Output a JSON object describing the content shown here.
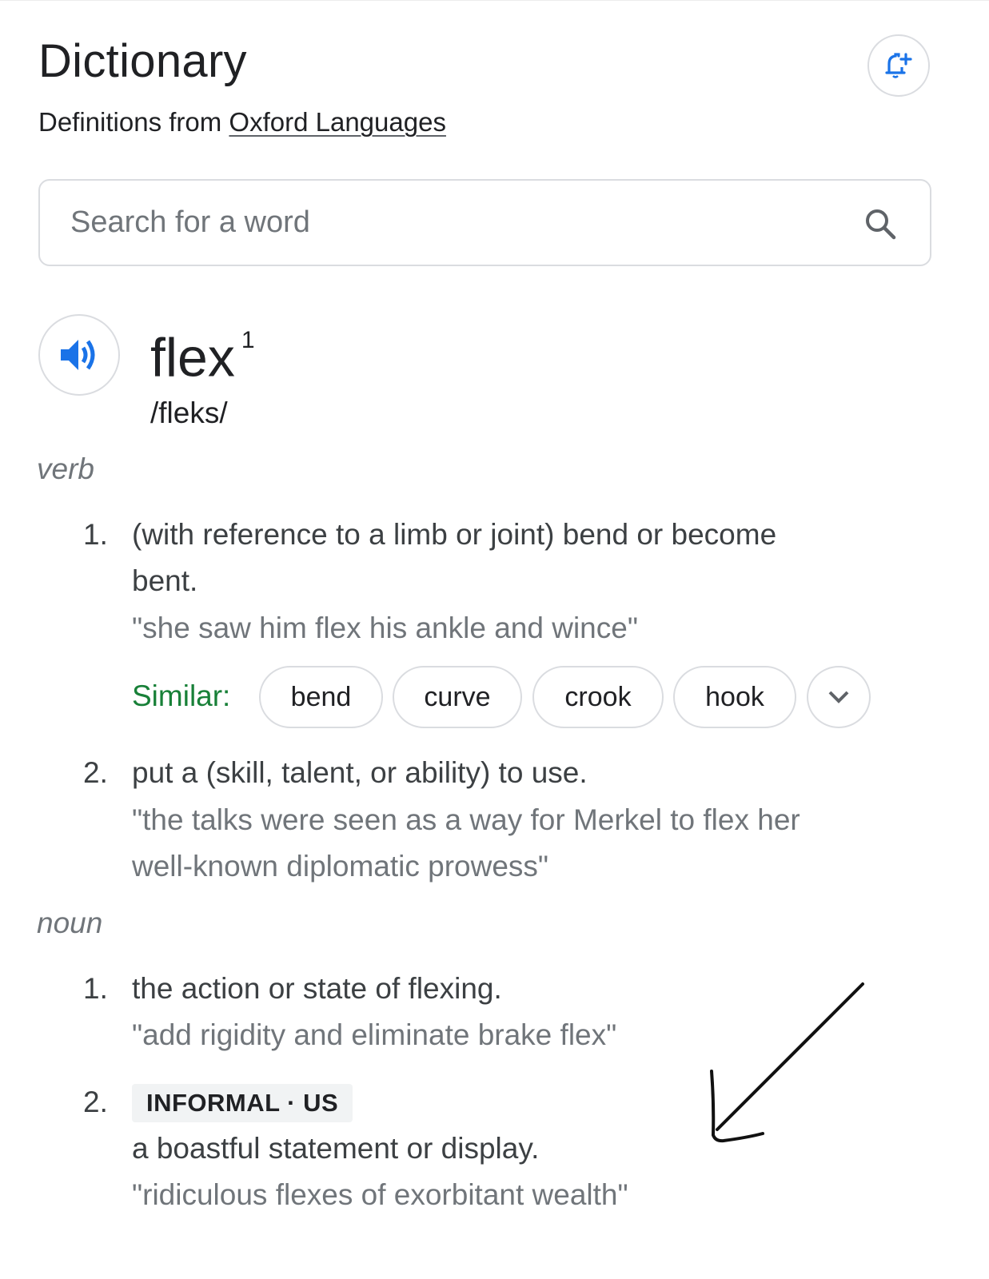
{
  "header": {
    "title": "Dictionary",
    "source_prefix": "Definitions from",
    "source_link": "Oxford Languages",
    "alert_icon": "bell-plus-icon"
  },
  "search": {
    "placeholder": "Search for a word",
    "value": "",
    "icon": "search-icon"
  },
  "entry": {
    "headword": "flex",
    "homograph": "1",
    "phonetic": "/fleks/",
    "audio_icon": "speaker-icon",
    "senses": [
      {
        "pos": "verb",
        "definitions": [
          {
            "number": "1.",
            "text_line1": "(with reference to a limb or joint) bend or become",
            "text_line2": "bent.",
            "example": "\"she saw him flex his ankle and wince\"",
            "similar_label": "Similar:",
            "similar": [
              "bend",
              "curve",
              "crook",
              "hook"
            ],
            "more_icon": "chevron-down-icon"
          },
          {
            "number": "2.",
            "text": "put a (skill, talent, or ability) to use.",
            "example_line1": "\"the talks were seen as a way for Merkel to flex her",
            "example_line2": "well-known diplomatic prowess\""
          }
        ]
      },
      {
        "pos": "noun",
        "definitions": [
          {
            "number": "1.",
            "text": "the action or state of flexing.",
            "example": "\"add rigidity and eliminate brake flex\""
          },
          {
            "number": "2.",
            "label": "INFORMAL · US",
            "text": "a boastful statement or display.",
            "example": "\"ridiculous flexes of exorbitant wealth\""
          }
        ]
      }
    ]
  },
  "colors": {
    "accent_blue": "#1a73e8",
    "similar_green": "#188038",
    "text_primary": "#202124",
    "text_secondary": "#70757a",
    "border": "#dadce0"
  },
  "annotation": {
    "type": "hand-drawn-arrow",
    "direction": "down-left"
  }
}
